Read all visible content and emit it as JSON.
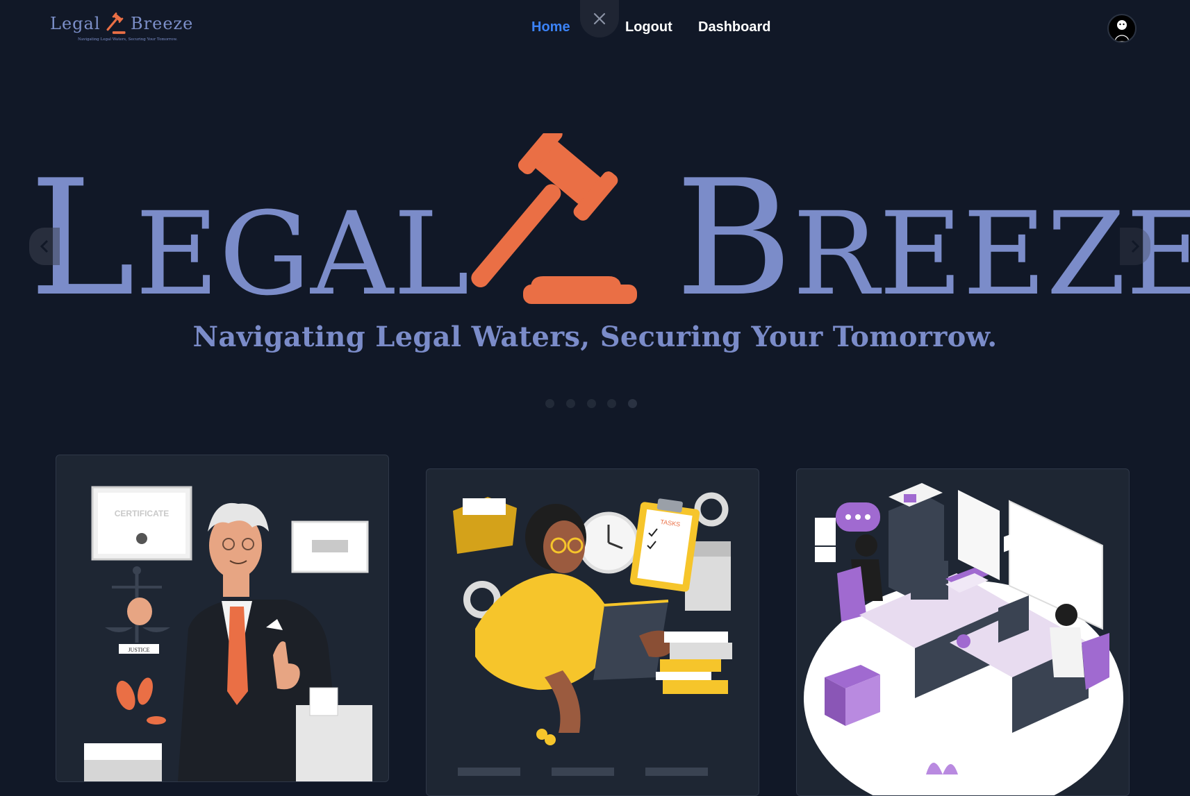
{
  "brand": {
    "name_word1": "Legal",
    "name_word2": "Breeze",
    "tagline": "Navigating Legal Waters, Securing Your Tomorrow."
  },
  "nav": {
    "links": [
      {
        "label": "Home",
        "active": true
      },
      {
        "label": "Logout",
        "active": false
      },
      {
        "label": "Dashboard",
        "active": false
      }
    ],
    "close_icon": "close-icon",
    "avatar_icon": "user-avatar"
  },
  "hero": {
    "word1_first": "L",
    "word1_rest": "EGAL",
    "word2_first": "B",
    "word2_rest": "REEZE",
    "tagline": "Navigating Legal Waters, Securing Your Tomorrow.",
    "slide_count": 5,
    "active_slide": 4
  },
  "cards": [
    {
      "illustration": "lawyer-thumbs-up",
      "certificate_text": "CERTIFICATE",
      "scale_label": "JUSTICE"
    },
    {
      "illustration": "woman-tasks-clipboard",
      "clipboard_label": "TASKS"
    },
    {
      "illustration": "office-workers-desks"
    }
  ],
  "colors": {
    "background": "#111827",
    "brand_blue": "#7b8cc9",
    "gavel_orange": "#ea6f45",
    "nav_active": "#3b82f6",
    "card_bg": "#1e2633"
  }
}
